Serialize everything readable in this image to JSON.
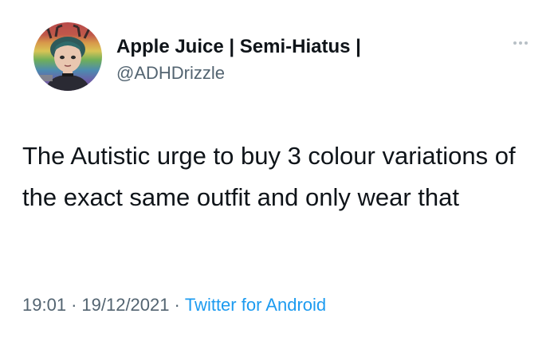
{
  "author": {
    "display_name": "Apple Juice | Semi-Hiatus |",
    "handle": "@ADHDrizzle",
    "avatar_icon": "illustrated-avatar-icon"
  },
  "tweet": {
    "text": "The Autistic urge to buy 3 colour variations of the exact same outfit and only wear that"
  },
  "meta": {
    "time": "19:01",
    "date": "19/12/2021",
    "separator": "·",
    "source": "Twitter for Android"
  },
  "colors": {
    "text": "#0f1419",
    "secondary": "#536471",
    "link": "#1d9bf0"
  }
}
